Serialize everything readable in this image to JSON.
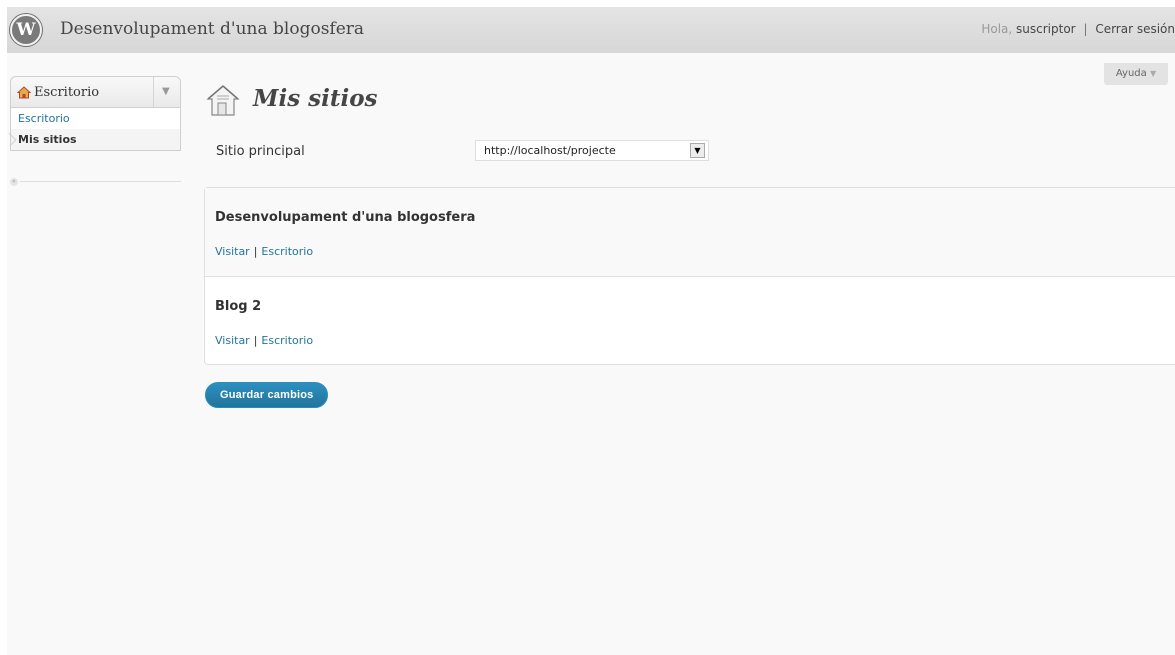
{
  "header": {
    "logo_letter": "W",
    "site_title": "Desenvolupament d'una blogosfera",
    "greeting": "Hola,",
    "username": "suscriptor",
    "separator": "|",
    "logout": "Cerrar sesión"
  },
  "help_tab": {
    "label": "Ayuda",
    "arrow": "▼"
  },
  "sidebar": {
    "menu_label": "Escritorio",
    "toggle_arrow": "▼",
    "items": [
      {
        "label": "Escritorio",
        "current": false
      },
      {
        "label": "Mis sitios",
        "current": true
      }
    ],
    "collapse_symbol": "«"
  },
  "main": {
    "page_title": "Mis sitios",
    "primary_site_label": "Sitio principal",
    "primary_site_value": "http://localhost/projecte",
    "select_arrow": "▼",
    "sites": [
      {
        "name": "Desenvolupament d'una blogosfera",
        "visit": "Visitar",
        "separator": "|",
        "dashboard": "Escritorio"
      },
      {
        "name": "Blog 2",
        "visit": "Visitar",
        "separator": "|",
        "dashboard": "Escritorio"
      }
    ],
    "save_label": "Guardar cambios"
  },
  "colors": {
    "link": "#21759b",
    "button": "#21759b",
    "header_bg": "#d9d9d9",
    "page_bg": "#f9f9f9"
  },
  "icons": [
    "wordpress-logo-icon",
    "home-icon",
    "house-page-icon",
    "chevron-down-icon",
    "collapse-icon"
  ]
}
